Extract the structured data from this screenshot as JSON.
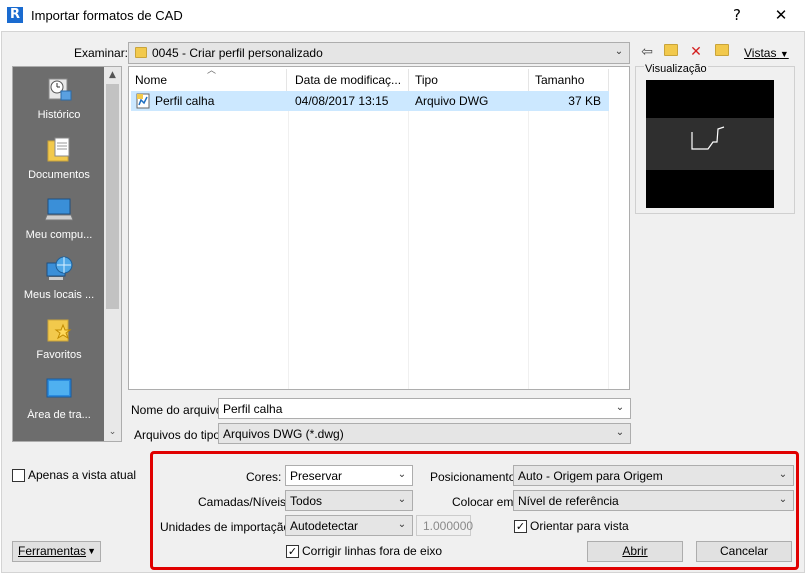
{
  "window": {
    "title": "Importar formatos de CAD",
    "help_glyph": "?",
    "close_glyph": "✕"
  },
  "toolbar": {
    "look_in_label": "Examinar:",
    "look_in_value": "0045 - Criar perfil personalizado",
    "views_label": "Vistas"
  },
  "places": [
    {
      "label": "Histórico",
      "icon": "history-icon"
    },
    {
      "label": "Documentos",
      "icon": "documents-folder-icon"
    },
    {
      "label": "Meu compu...",
      "icon": "computer-icon"
    },
    {
      "label": "Meus locais ...",
      "icon": "network-globe-icon"
    },
    {
      "label": "Favoritos",
      "icon": "favorites-folder-icon"
    },
    {
      "label": "Área de tra...",
      "icon": "desktop-icon"
    }
  ],
  "file_list": {
    "columns": [
      "Nome",
      "Data de modificaç...",
      "Tipo",
      "Tamanho"
    ],
    "rows": [
      {
        "name": "Perfil calha",
        "modified": "04/08/2017 13:15",
        "type": "Arquivo DWG",
        "size": "37 KB"
      }
    ]
  },
  "preview": {
    "label": "Visualização"
  },
  "filename": {
    "label": "Nome do arquivo:",
    "value": "Perfil calha"
  },
  "filetype": {
    "label": "Arquivos do tipo:",
    "value": "Arquivos DWG  (*.dwg)"
  },
  "options": {
    "current_view_only": {
      "label": "Apenas a vista atual",
      "checked": false
    },
    "colors": {
      "label": "Cores:",
      "value": "Preservar"
    },
    "layers": {
      "label": "Camadas/Níveis:",
      "value": "Todos"
    },
    "import_units": {
      "label": "Unidades de importação:",
      "value": "Autodetectar",
      "scale": "1.000000"
    },
    "correct_lines": {
      "label": "Corrigir linhas fora de eixo",
      "checked": true
    },
    "positioning": {
      "label": "Posicionamento:",
      "value": "Auto - Origem para Origem"
    },
    "place_at": {
      "label": "Colocar em:",
      "value": "Nível de referência"
    },
    "orient_to_view": {
      "label": "Orientar para vista",
      "checked": true
    }
  },
  "buttons": {
    "tools": "Ferramentas",
    "open": "Abrir",
    "cancel": "Cancelar"
  },
  "colors": {
    "highlight_box": "#e00000",
    "selected_row": "#cce8ff",
    "places_bg": "#6d6d6d"
  }
}
